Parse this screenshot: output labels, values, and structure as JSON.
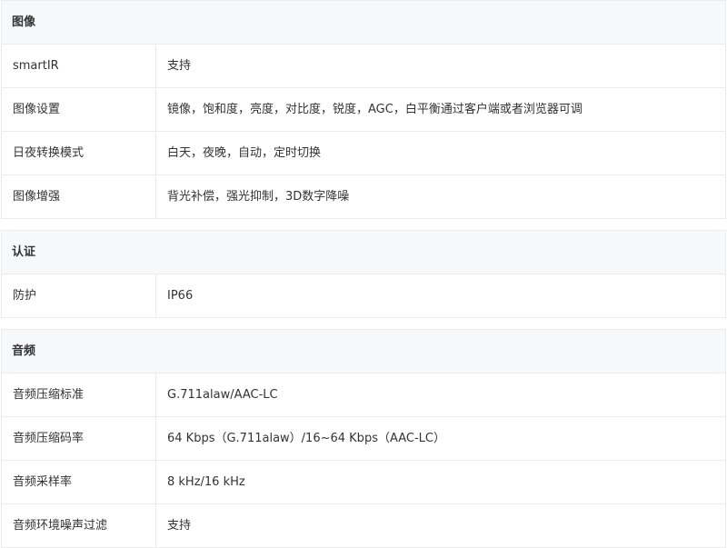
{
  "sections": [
    {
      "title": "图像",
      "rows": [
        {
          "label": "smartIR",
          "value": "支持"
        },
        {
          "label": "图像设置",
          "value": "镜像，饱和度，亮度，对比度，锐度，AGC，白平衡通过客户端或者浏览器可调"
        },
        {
          "label": "日夜转换模式",
          "value": "白天，夜晚，自动，定时切换"
        },
        {
          "label": "图像增强",
          "value": "背光补偿，强光抑制，3D数字降噪"
        }
      ]
    },
    {
      "title": "认证",
      "rows": [
        {
          "label": "防护",
          "value": "IP66"
        }
      ]
    },
    {
      "title": "音频",
      "rows": [
        {
          "label": "音频压缩标准",
          "value": "G.711alaw/AAC-LC"
        },
        {
          "label": "音频压缩码率",
          "value": "64 Kbps（G.711alaw）/16~64 Kbps（AAC-LC）"
        },
        {
          "label": "音频采样率",
          "value": "8 kHz/16 kHz"
        },
        {
          "label": "音频环境噪声过滤",
          "value": "支持"
        }
      ]
    }
  ]
}
